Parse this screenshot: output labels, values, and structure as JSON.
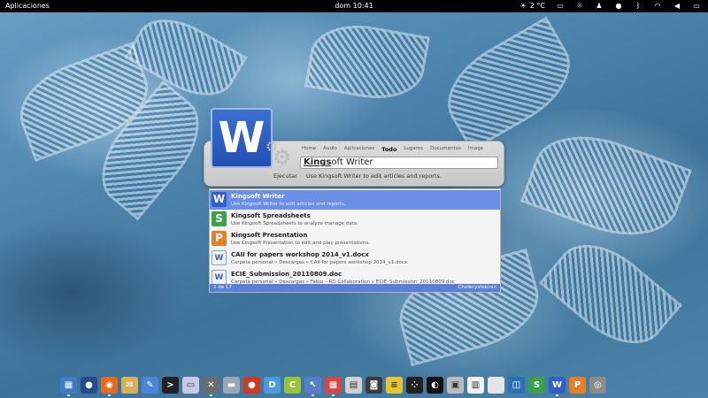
{
  "topbar": {
    "apps_label": "Aplicaciones",
    "clock": "dom 10:41",
    "weather": "2 °C",
    "indicators": [
      "weather-icon",
      "window-icon",
      "brightness-icon",
      "user-icon",
      "mail-icon",
      "bluetooth-icon",
      "network-icon",
      "volume-icon",
      "battery-icon"
    ]
  },
  "launcher": {
    "tabs": [
      "Home",
      "Audio",
      "Aplicaciones",
      "Todo",
      "Lugares",
      "Documentos",
      "Image"
    ],
    "active_tab": "Todo",
    "search_highlight": "Kings",
    "search_rest": "oft Writer",
    "action_label": "Ejecutar",
    "action_desc": "Use Kingsoft Writer to edit articles and reports."
  },
  "results": [
    {
      "title": "Kingsoft Writer",
      "desc": "Use Kingsoft Writer to edit articles and reports.",
      "icon": "W",
      "type": "writer"
    },
    {
      "title": "Kingsoft Spreadsheets",
      "desc": "Use Kingsoft Spreadsheets to analyze manage data.",
      "icon": "S",
      "type": "sheets"
    },
    {
      "title": "Kingsoft Presentation",
      "desc": "Use Kingsoft Presentation to edit and play presentations.",
      "icon": "P",
      "type": "pres"
    },
    {
      "title": "CAII for papers workshop 2014_v1.docx",
      "desc": "Carpeta personal » Descargas » CAII for papers workshop 2014_v1.docx",
      "icon": "W",
      "type": "doc"
    },
    {
      "title": "ECIE_Submission_20110809.doc",
      "desc": "Carpeta personal » Descargas » Fabio – RD Collaboration » ECIE_Submission_20110809.doc",
      "icon": "W",
      "type": "doc"
    }
  ],
  "status": {
    "count": "1 de 17",
    "user": "Cholecystokinin"
  },
  "dock": [
    {
      "name": "file-manager-icon",
      "color": "#3d7cc9",
      "glyph": "▦"
    },
    {
      "name": "globe-icon",
      "color": "#1f4e8a",
      "glyph": "●"
    },
    {
      "name": "firefox-icon",
      "color": "#e86a1c",
      "glyph": "◉"
    },
    {
      "name": "mail-app-icon",
      "color": "#d9b15a",
      "glyph": "✉"
    },
    {
      "name": "tool-icon",
      "color": "#4b86d6",
      "glyph": "✎"
    },
    {
      "name": "terminal-icon",
      "color": "#222222",
      "glyph": ">"
    },
    {
      "name": "media-icon",
      "color": "#c9c9e0",
      "glyph": "▭"
    },
    {
      "name": "tools-icon",
      "color": "#6c6c6c",
      "glyph": "✕"
    },
    {
      "name": "folder-icon",
      "color": "#9aa7b5",
      "glyph": "▬"
    },
    {
      "name": "tomato-icon",
      "color": "#d2381d",
      "glyph": "●"
    },
    {
      "name": "d-app-icon",
      "color": "#4a9be0",
      "glyph": "D"
    },
    {
      "name": "c-app-icon",
      "color": "#9ac23a",
      "glyph": "C"
    },
    {
      "name": "pointer-app-icon",
      "color": "#5580c8",
      "glyph": "↖"
    },
    {
      "name": "grid-app-icon",
      "color": "#d94545",
      "glyph": "▦"
    },
    {
      "name": "calendar-icon",
      "color": "#d0d0d0",
      "glyph": "▤"
    },
    {
      "name": "camera-icon",
      "color": "#3a3a3a",
      "glyph": "◙"
    },
    {
      "name": "notes-icon",
      "color": "#e6c531",
      "glyph": "≡"
    },
    {
      "name": "dots-app-icon",
      "color": "#222222",
      "glyph": "⁘"
    },
    {
      "name": "dark-app-icon",
      "color": "#111111",
      "glyph": "◐"
    },
    {
      "name": "photo-icon",
      "color": "#bbbbbb",
      "glyph": "▣"
    },
    {
      "name": "document-icon",
      "color": "#f0f0f0",
      "glyph": "▥"
    },
    {
      "name": "blank-icon",
      "color": "#e5e5e5",
      "glyph": ""
    },
    {
      "name": "frame-icon",
      "color": "#2b6fb5",
      "glyph": "◫"
    },
    {
      "name": "s-app-icon",
      "color": "#3aa34a",
      "glyph": "S"
    },
    {
      "name": "writer-dock-icon",
      "color": "#2f5fc9",
      "glyph": "W"
    },
    {
      "name": "presentation-dock-icon",
      "color": "#e58027",
      "glyph": "P"
    },
    {
      "name": "disc-icon",
      "color": "#8c8c8c",
      "glyph": "◎"
    }
  ]
}
